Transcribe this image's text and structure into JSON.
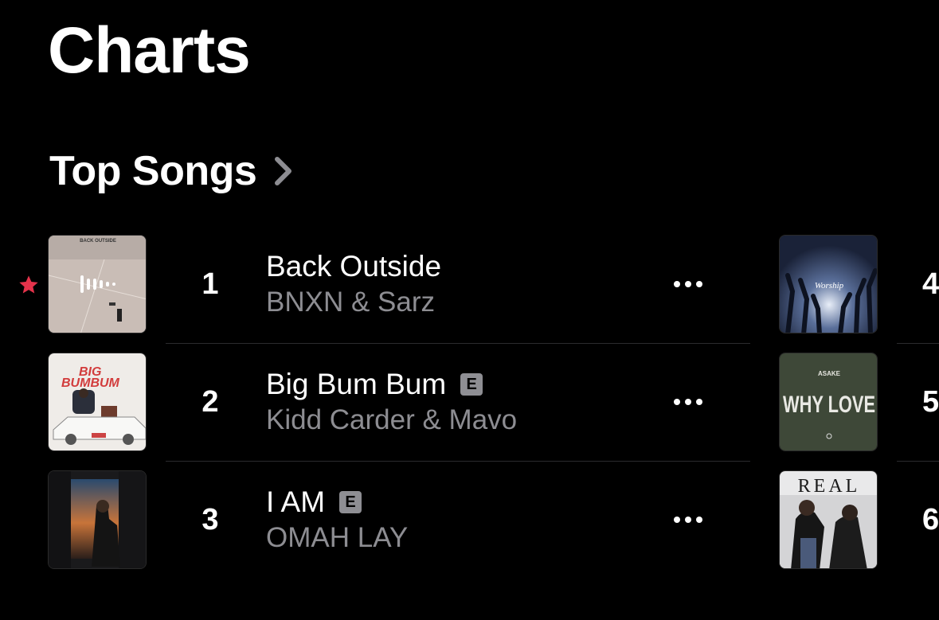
{
  "page": {
    "title": "Charts"
  },
  "section": {
    "title": "Top Songs"
  },
  "songs": [
    {
      "rank": "1",
      "title": "Back Outside",
      "artist": "BNXN & Sarz",
      "explicit": false,
      "favorite": true,
      "art_icon": "album-art-back-outside",
      "art_text": "BACK OUTSIDE"
    },
    {
      "rank": "2",
      "title": "Big Bum Bum",
      "artist": "Kidd Carder & Mavo",
      "explicit": true,
      "art_icon": "album-art-big-bum-bum",
      "art_text": "BIG BUMBUM"
    },
    {
      "rank": "3",
      "title": "I AM",
      "artist": "OMAH LAY",
      "explicit": true,
      "art_icon": "album-art-i-am"
    }
  ],
  "right_column": [
    {
      "rank": "4",
      "art_icon": "album-art-worship",
      "art_text": "Worship"
    },
    {
      "rank": "5",
      "art_icon": "album-art-why-love",
      "art_text": "WHY LOVE",
      "art_subtext": "ASAKE"
    },
    {
      "rank": "6",
      "art_icon": "album-art-real",
      "art_text": "REAL"
    }
  ],
  "explicit_badge": "E",
  "colors": {
    "background": "#000000",
    "secondary_text": "#8d8d92",
    "favorite_star": "#e5334b",
    "explicit_badge": "#8e8e93"
  }
}
